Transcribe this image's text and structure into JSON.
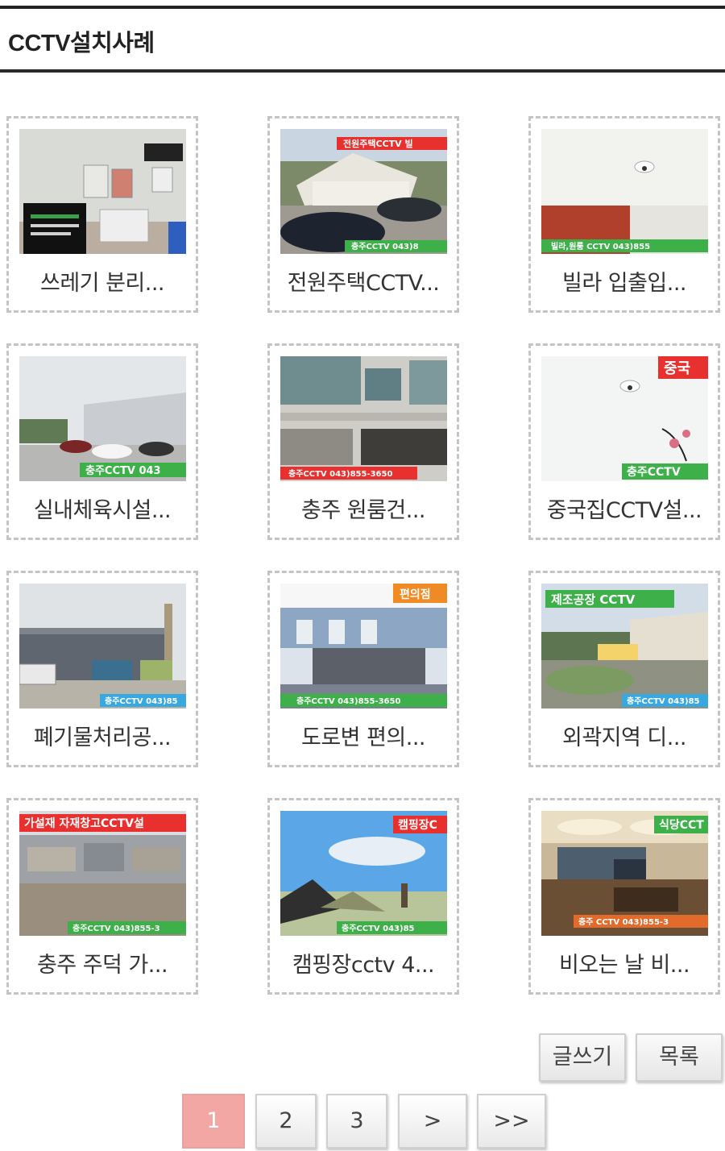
{
  "board": {
    "title": "CCTV설치사례"
  },
  "gallery": {
    "items": [
      {
        "caption": "쓰레기 분리...",
        "overlay": ""
      },
      {
        "caption": "전원주택CCTV...",
        "overlay": "전원주택CCTV 빌",
        "watermark": "충주CCTV 043)8"
      },
      {
        "caption": "빌라 입출입...",
        "watermark": "빌라,원룸 CCTV 043)855"
      },
      {
        "caption": "실내체육시설...",
        "watermark": "충주CCTV 043"
      },
      {
        "caption": "충주 원룸건...",
        "watermark": "충주CCTV 043)855-3650"
      },
      {
        "caption": "중국집CCTV설...",
        "overlay": "중국",
        "watermark": "충주CCTV"
      },
      {
        "caption": "폐기물처리공...",
        "watermark": "충주CCTV 043)85"
      },
      {
        "caption": "도로변 편의...",
        "overlay": "편의점",
        "watermark": "충주CCTV 043)855-3650"
      },
      {
        "caption": "외곽지역 디...",
        "overlay": "제조공장 CCTV",
        "watermark": "충주CCTV 043)85"
      },
      {
        "caption": "충주 주덕 가...",
        "overlay": "가설재 자재창고CCTV설",
        "watermark": "충주CCTV 043)855-3"
      },
      {
        "caption": "캠핑장cctv 4...",
        "overlay": "캠핑장C",
        "watermark": "충주CCTV 043)85"
      },
      {
        "caption": "비오는 날 비...",
        "overlay": "식당CCT",
        "watermark": "충주 CCTV 043)855-3"
      }
    ]
  },
  "actions": {
    "write_label": "글쓰기",
    "list_label": "목록"
  },
  "pagination": {
    "pages": [
      "1",
      "2",
      "3"
    ],
    "current": "1",
    "next_label": ">",
    "last_label": ">>"
  },
  "colors": {
    "active_page": "#f3a7a5",
    "watermark_green": "#3db04a",
    "overlay_red": "#e8312f"
  }
}
